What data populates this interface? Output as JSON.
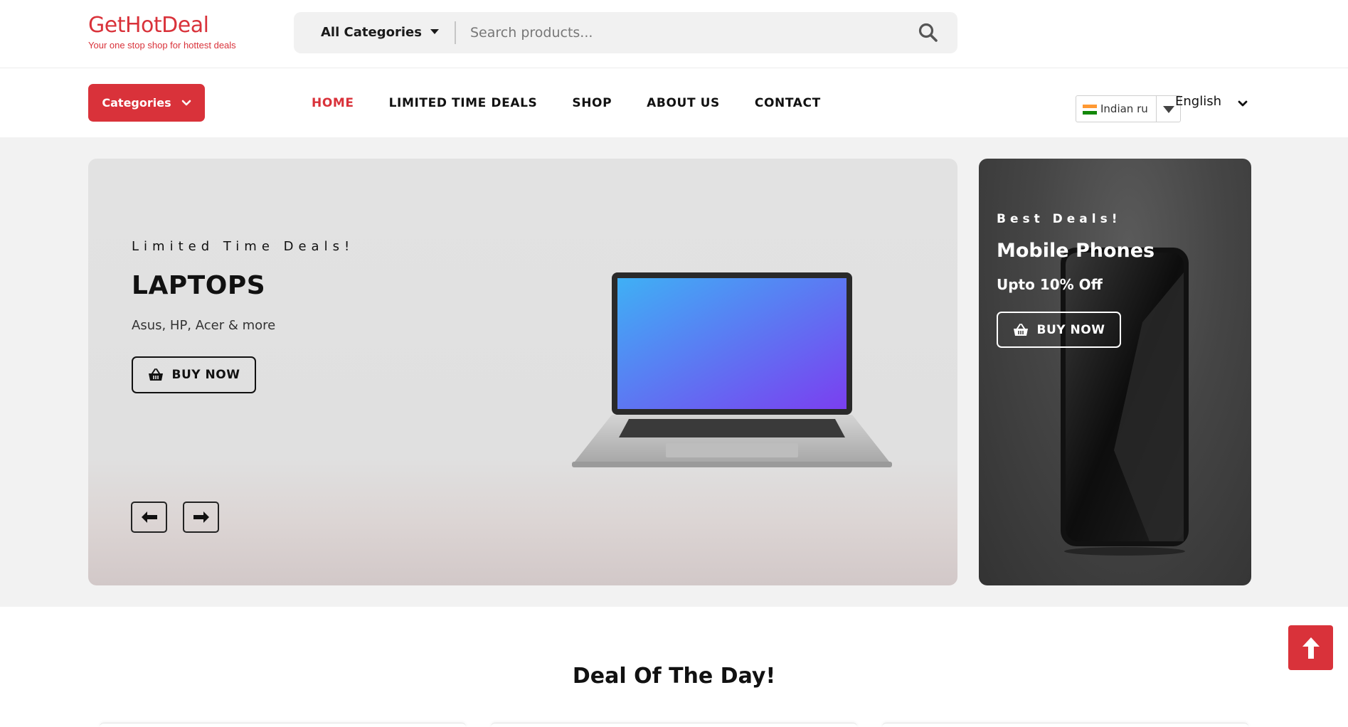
{
  "header": {
    "logo_name": "GetHotDeal",
    "logo_tagline": "Your one stop shop for hottest deals",
    "search": {
      "category_label": "All Categories",
      "placeholder": "Search products..."
    }
  },
  "nav": {
    "categories_label": "Categories",
    "links": [
      {
        "label": "HOME",
        "active": true
      },
      {
        "label": "LIMITED TIME DEALS",
        "active": false
      },
      {
        "label": "SHOP",
        "active": false
      },
      {
        "label": "ABOUT US",
        "active": false
      },
      {
        "label": "CONTACT",
        "active": false
      }
    ],
    "currency_label": "Indian ru",
    "language_label": "English"
  },
  "hero": {
    "main": {
      "kicker": "Limited Time Deals!",
      "title": "LAPTOPS",
      "subtitle": "Asus, HP, Acer & more",
      "button_label": "BUY NOW"
    },
    "side": {
      "kicker": "Best Deals!",
      "title": "Mobile Phones",
      "subtitle": "Upto 10% Off",
      "button_label": "BUY NOW"
    }
  },
  "deal_section": {
    "title": "Deal Of The Day!"
  },
  "colors": {
    "brand": "#d9323a",
    "hero_bg": "#e0e0e0",
    "side_bg": "#454545"
  },
  "icons": {
    "search": "search-icon",
    "caret": "caret-down-icon",
    "chevron": "chevron-down-icon",
    "basket": "basket-icon",
    "arrow_left": "arrow-left-icon",
    "arrow_right": "arrow-right-icon",
    "scroll_top": "arrow-up-icon",
    "flag": "india-flag-icon"
  }
}
